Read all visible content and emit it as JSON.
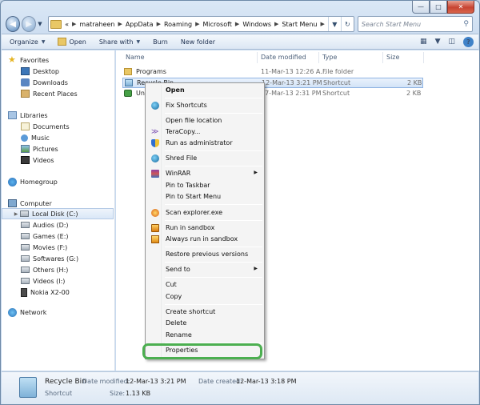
{
  "address": {
    "overflow": "«",
    "crumbs": [
      "matraheen",
      "AppData",
      "Roaming",
      "Microsoft",
      "Windows",
      "Start Menu"
    ]
  },
  "search": {
    "placeholder": "Search Start Menu"
  },
  "toolbar": {
    "organize": "Organize",
    "open": "Open",
    "share": "Share with",
    "burn": "Burn",
    "new_folder": "New folder"
  },
  "nav": {
    "favorites": "Favorites",
    "desktop": "Desktop",
    "downloads": "Downloads",
    "recent": "Recent Places",
    "libraries": "Libraries",
    "documents": "Documents",
    "music": "Music",
    "pictures": "Pictures",
    "videos": "Videos",
    "homegroup": "Homegroup",
    "computer": "Computer",
    "drives": [
      "Local Disk (C:)",
      "Audios (D:)",
      "Games (E:)",
      "Movies (F:)",
      "Softwares (G:)",
      "Others (H:)",
      "Videos (I:)",
      "Nokia X2-00"
    ],
    "network": "Network"
  },
  "columns": {
    "name": "Name",
    "date": "Date modified",
    "type": "Type",
    "size": "Size"
  },
  "files": [
    {
      "name": "Programs",
      "date": "11-Mar-13 12:26 A...",
      "type": "File folder",
      "size": ""
    },
    {
      "name": "Recycle Bin",
      "date": "12-Mar-13 3:21 PM",
      "type": "Shortcut",
      "size": "2 KB"
    },
    {
      "name": "Unin",
      "date": "17-Mar-13 2:31 PM",
      "type": "Shortcut",
      "size": "2 KB"
    }
  ],
  "menu": {
    "open": "Open",
    "fix_shortcuts": "Fix Shortcuts",
    "open_location": "Open file location",
    "teracopy": "TeraCopy...",
    "run_admin": "Run as administrator",
    "shred": "Shred File",
    "winrar": "WinRAR",
    "pin_taskbar": "Pin to Taskbar",
    "pin_start": "Pin to Start Menu",
    "scan": "Scan explorer.exe",
    "run_sandbox": "Run in sandbox",
    "always_sandbox": "Always run in sandbox",
    "restore": "Restore previous versions",
    "send_to": "Send to",
    "cut": "Cut",
    "copy": "Copy",
    "create_shortcut": "Create shortcut",
    "delete": "Delete",
    "rename": "Rename",
    "properties": "Properties"
  },
  "details": {
    "name": "Recycle Bin",
    "kind": "Shortcut",
    "date_modified_label": "Date modified:",
    "date_modified": "12-Mar-13 3:21 PM",
    "date_created_label": "Date created:",
    "date_created": "12-Mar-13 3:18 PM",
    "size_label": "Size:",
    "size": "1.13 KB"
  },
  "colors": {
    "highlight": "#4caf50",
    "selection": "#d2e3f7"
  }
}
